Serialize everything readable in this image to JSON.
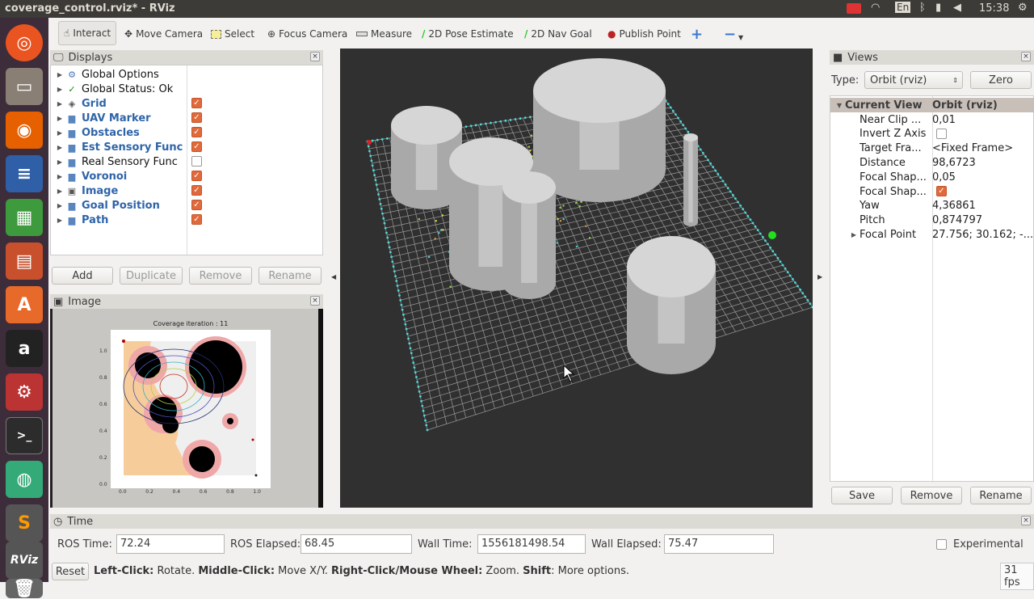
{
  "window": {
    "title": "coverage_control.rviz* - RViz",
    "keyboard": "En",
    "clock": "15:38"
  },
  "launcher": {
    "items": [
      "ubuntu-icon",
      "files-icon",
      "firefox-icon",
      "writer-icon",
      "calc-icon",
      "impress-icon",
      "software-icon",
      "amazon-icon",
      "settings-icon",
      "terminal-icon",
      "chrome-icon",
      "sublime-icon",
      "rviz-icon",
      "trash-icon"
    ],
    "rviz_label": "RViz"
  },
  "toolbar": {
    "tools": [
      {
        "label": "Interact",
        "icon": "hand-icon"
      },
      {
        "label": "Move Camera",
        "icon": "move-icon"
      },
      {
        "label": "Select",
        "icon": "select-icon"
      },
      {
        "label": "Focus Camera",
        "icon": "focus-icon"
      },
      {
        "label": "Measure",
        "icon": "ruler-icon"
      },
      {
        "label": "2D Pose Estimate",
        "icon": "green-arrow-icon"
      },
      {
        "label": "2D Nav Goal",
        "icon": "green-arrow-icon"
      },
      {
        "label": "Publish Point",
        "icon": "pin-icon"
      }
    ],
    "plus": "+",
    "minus": "−"
  },
  "displays": {
    "title": "Displays",
    "items": [
      {
        "label": "Global Options",
        "checked": null
      },
      {
        "label": "Global Status: Ok",
        "checked": null
      },
      {
        "label": "Grid",
        "checked": true
      },
      {
        "label": "UAV Marker",
        "checked": true
      },
      {
        "label": "Obstacles",
        "checked": true
      },
      {
        "label": "Est Sensory Func",
        "checked": true
      },
      {
        "label": "Real Sensory Func",
        "checked": false
      },
      {
        "label": "Voronoi",
        "checked": true
      },
      {
        "label": "Image",
        "checked": true
      },
      {
        "label": "Goal Position",
        "checked": true
      },
      {
        "label": "Path",
        "checked": true
      }
    ],
    "buttons": {
      "add": "Add",
      "duplicate": "Duplicate",
      "remove": "Remove",
      "rename": "Rename"
    }
  },
  "image_panel": {
    "title": "Image",
    "plot_title": "Coverage iteration : 11",
    "yticks": [
      "1.0",
      "0.8",
      "0.6",
      "0.4",
      "0.2",
      "0.0"
    ],
    "xticks": [
      "0.0",
      "0.2",
      "0.4",
      "0.6",
      "0.8",
      "1.0"
    ]
  },
  "views": {
    "title": "Views",
    "type_label": "Type:",
    "type_value": "Orbit (rviz)",
    "zero": "Zero",
    "header": {
      "name": "Current View",
      "value": "Orbit (rviz)"
    },
    "props": [
      {
        "name": "Near Clip ...",
        "value": "0,01"
      },
      {
        "name": "Invert Z Axis",
        "value": "",
        "checkbox": false
      },
      {
        "name": "Target Fra...",
        "value": "<Fixed Frame>"
      },
      {
        "name": "Distance",
        "value": "98,6723"
      },
      {
        "name": "Focal Shap...",
        "value": "0,05"
      },
      {
        "name": "Focal Shap...",
        "value": "",
        "checkbox": true
      },
      {
        "name": "Yaw",
        "value": "4,36861"
      },
      {
        "name": "Pitch",
        "value": "0,874797"
      },
      {
        "name": "Focal Point",
        "value": "27.756; 30.162; -..."
      }
    ],
    "buttons": {
      "save": "Save",
      "remove": "Remove",
      "rename": "Rename"
    }
  },
  "time": {
    "title": "Time",
    "ros_time_label": "ROS Time:",
    "ros_time": "72.24",
    "ros_elapsed_label": "ROS Elapsed:",
    "ros_elapsed": "68.45",
    "wall_time_label": "Wall Time:",
    "wall_time": "1556181498.54",
    "wall_elapsed_label": "Wall Elapsed:",
    "wall_elapsed": "75.47",
    "experimental": "Experimental"
  },
  "status": {
    "reset": "Reset",
    "b1": "Left-Click:",
    "t1": " Rotate. ",
    "b2": "Middle-Click:",
    "t2": " Move X/Y. ",
    "b3": "Right-Click/Mouse Wheel:",
    "t3": " Zoom. ",
    "b4": "Shift",
    "t4": ": More options.",
    "fps": "31 fps"
  }
}
